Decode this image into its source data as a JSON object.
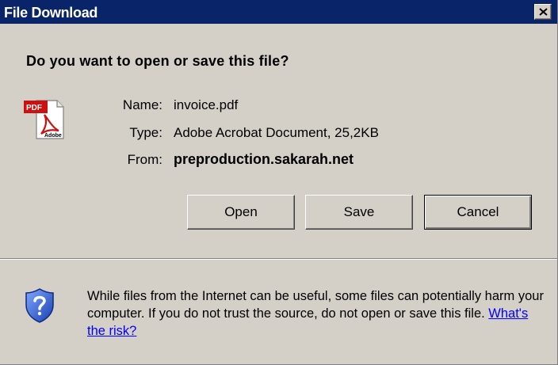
{
  "window": {
    "title": "File Download"
  },
  "dialog": {
    "question": "Do you want to open or save this file?",
    "file": {
      "name_label": "Name:",
      "name": "invoice.pdf",
      "type_label": "Type:",
      "type": "Adobe Acrobat Document, 25,2KB",
      "from_label": "From:",
      "from": "preproduction.sakarah.net",
      "icon": "pdf-file-icon",
      "icon_badge": "PDF",
      "icon_text": "Adobe"
    },
    "buttons": {
      "open": "Open",
      "save": "Save",
      "cancel": "Cancel"
    },
    "warning": {
      "text": "While files from the Internet can be useful, some files can potentially harm your computer. If you do not trust the source, do not open or save this file.",
      "link": "What's the risk?",
      "icon": "shield-question-icon"
    }
  },
  "colors": {
    "titlebar": "#0a246a",
    "dialog_bg": "#d4d0c8",
    "link": "#0000ff"
  }
}
